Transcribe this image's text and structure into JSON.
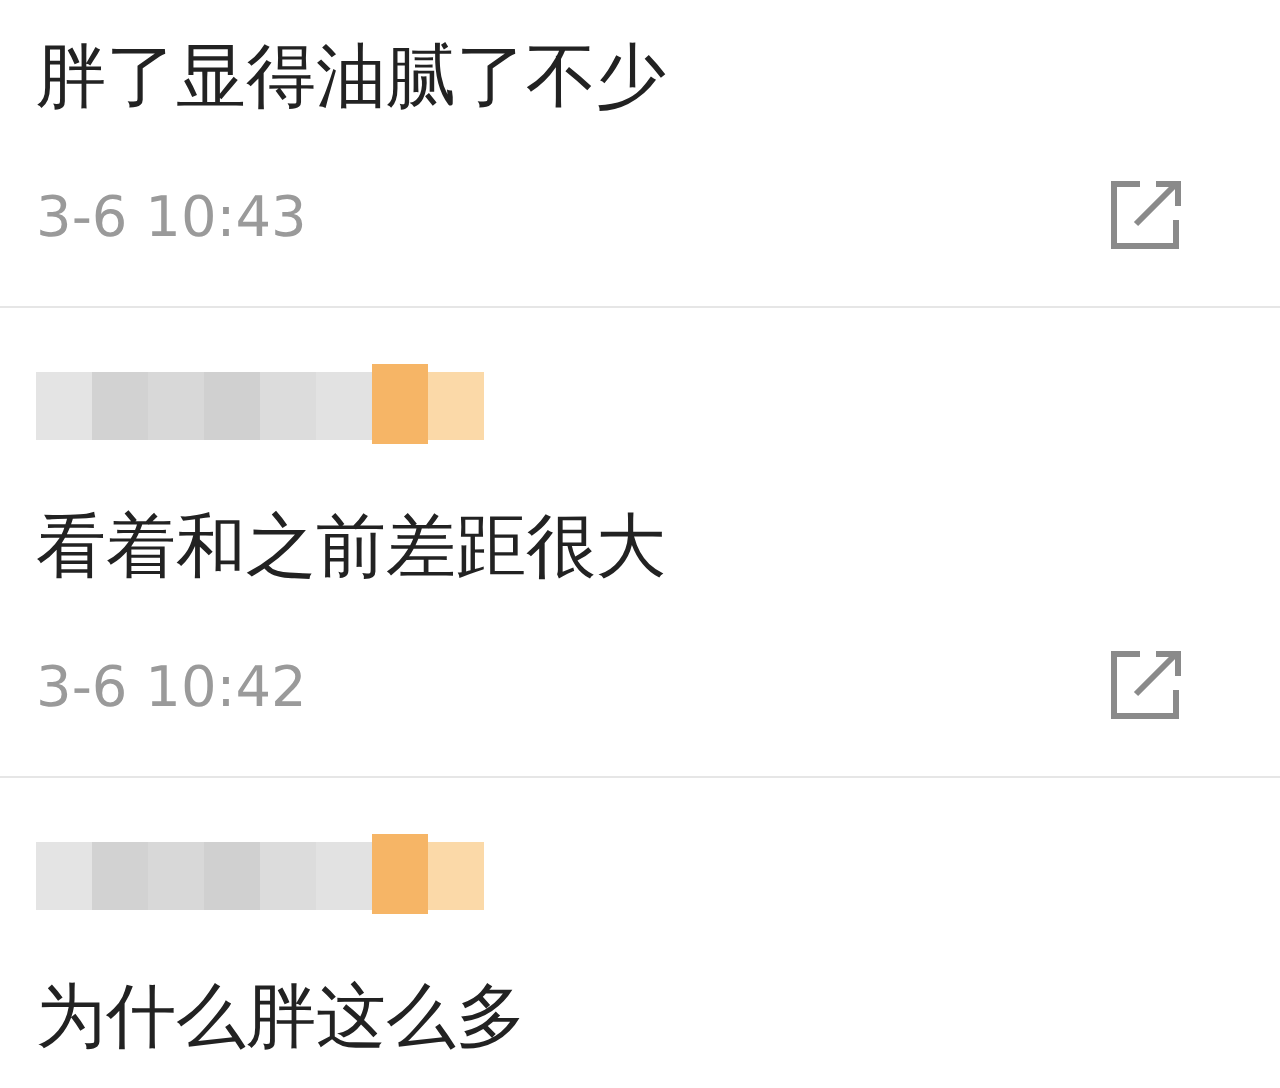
{
  "comments": [
    {
      "name_blurred": false,
      "text": "胖了显得油腻了不少",
      "time": "3-6 10:43"
    },
    {
      "name_blurred": true,
      "text": "看着和之前差距很大",
      "time": "3-6 10:42"
    },
    {
      "name_blurred": true,
      "text": "为什么胖这么多"
    }
  ]
}
